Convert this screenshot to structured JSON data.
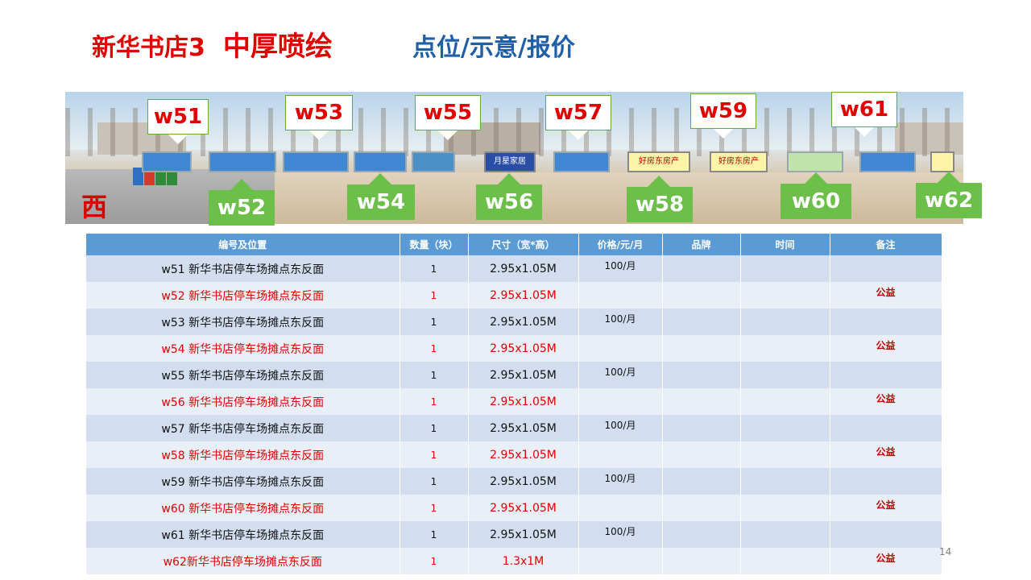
{
  "title": {
    "main": "新华书店3",
    "sub": "中厚喷绘",
    "right": "点位/示意/报价"
  },
  "photo": {
    "direction_char": "西",
    "labels_top": [
      "w51",
      "w53",
      "w55",
      "w57",
      "w59",
      "w61"
    ],
    "labels_bottom": [
      "w52",
      "w54",
      "w56",
      "w58",
      "w60",
      "w62"
    ],
    "sign_texts": [
      "月星家居",
      "好房东房产",
      "好房东房产"
    ]
  },
  "table": {
    "headers": [
      "编号及位置",
      "数量（块）",
      "尺寸（宽*高）",
      "价格/元/月",
      "品牌",
      "时间",
      "备注"
    ],
    "rows": [
      {
        "pos": "w51 新华书店停车场摊点东反面",
        "qty": "1",
        "size": "2.95x1.05M",
        "price": "100/月",
        "brand": "",
        "time": "",
        "note": ""
      },
      {
        "pos": "w52 新华书店停车场摊点东反面",
        "qty": "1",
        "size": "2.95x1.05M",
        "price": "",
        "brand": "",
        "time": "",
        "note": "公益"
      },
      {
        "pos": "w53  新华书店停车场摊点东反面",
        "qty": "1",
        "size": "2.95x1.05M",
        "price": "100/月",
        "brand": "",
        "time": "",
        "note": ""
      },
      {
        "pos": "w54  新华书店停车场摊点东反面",
        "qty": "1",
        "size": "2.95x1.05M",
        "price": "",
        "brand": "",
        "time": "",
        "note": "公益"
      },
      {
        "pos": "w55  新华书店停车场摊点东反面",
        "qty": "1",
        "size": "2.95x1.05M",
        "price": "100/月",
        "brand": "",
        "time": "",
        "note": ""
      },
      {
        "pos": "w56  新华书店停车场摊点东反面",
        "qty": "1",
        "size": "2.95x1.05M",
        "price": "",
        "brand": "",
        "time": "",
        "note": "公益"
      },
      {
        "pos": "w57  新华书店停车场摊点东反面",
        "qty": "1",
        "size": "2.95x1.05M",
        "price": "100/月",
        "brand": "",
        "time": "",
        "note": ""
      },
      {
        "pos": "w58 新华书店停车场摊点东反面",
        "qty": "1",
        "size": "2.95x1.05M",
        "price": "",
        "brand": "",
        "time": "",
        "note": "公益"
      },
      {
        "pos": "w59  新华书店停车场摊点东反面",
        "qty": "1",
        "size": "2.95x1.05M",
        "price": "100/月",
        "brand": "",
        "time": "",
        "note": ""
      },
      {
        "pos": "w60  新华书店停车场摊点东反面",
        "qty": "1",
        "size": "2.95x1.05M",
        "price": "",
        "brand": "",
        "time": "",
        "note": "公益"
      },
      {
        "pos": "w61  新华书店停车场摊点东反面",
        "qty": "1",
        "size": "2.95x1.05M",
        "price": "100/月",
        "brand": "",
        "time": "",
        "note": ""
      },
      {
        "pos": "w62新华书店停车场摊点东反面",
        "qty": "1",
        "size": "1.3x1M",
        "price": "",
        "brand": "",
        "time": "",
        "note": "公益"
      }
    ]
  },
  "page_number": "14",
  "colors": {
    "title_red": "#e00000",
    "title_blue": "#1f5fa8",
    "header_blue": "#5b9bd5",
    "label_green": "#6cc04a"
  }
}
